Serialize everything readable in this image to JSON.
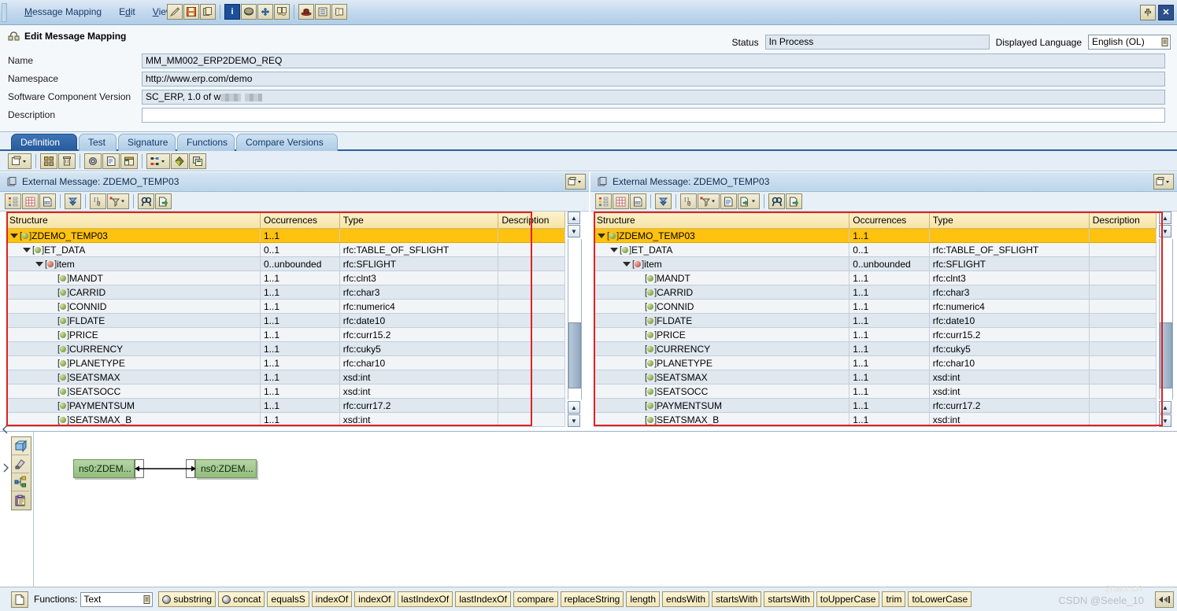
{
  "menubar": {
    "items": [
      {
        "label": "Message Mapping",
        "mnemonic": "M"
      },
      {
        "label": "Edit",
        "mnemonic": "d"
      },
      {
        "label": "View",
        "mnemonic": "V"
      }
    ],
    "toolbar_groups": [
      {
        "icons": [
          "pencil-edit-icon",
          "save-icon",
          "copy-icon"
        ]
      },
      {
        "icons": [
          "info-icon",
          "book-icon",
          "where-used-icon",
          "history-icon"
        ]
      },
      {
        "icons": [
          "hat-icon",
          "list-icon",
          "scroll-icon"
        ]
      }
    ],
    "window_buttons": [
      "pin-icon",
      "close-icon"
    ]
  },
  "header": {
    "title": "Edit Message Mapping",
    "title_icon": "message-mapping-icon",
    "fields": [
      {
        "label": "Name",
        "value": "MM_MM002_ERP2DEMO_REQ",
        "readonly": true
      },
      {
        "label": "Namespace",
        "value": "http://www.erp.com/demo",
        "readonly": true
      },
      {
        "label": "Software Component Version",
        "value": "SC_ERP, 1.0 of w",
        "readonly": true,
        "redacted": true
      },
      {
        "label": "Description",
        "value": "",
        "readonly": false
      }
    ],
    "status_label": "Status",
    "status_value": "In Process",
    "language_label": "Displayed Language",
    "language_value": "English (OL)"
  },
  "tabs": [
    {
      "label": "Definition",
      "active": true
    },
    {
      "label": "Test",
      "active": false
    },
    {
      "label": "Signature",
      "active": false
    },
    {
      "label": "Functions",
      "active": false
    },
    {
      "label": "Compare Versions",
      "active": false
    }
  ],
  "action_toolbar": {
    "groups": [
      {
        "icons": [
          "new-window-dropdown-icon"
        ]
      },
      {
        "icons": [
          "grid-arrange-icon",
          "delete-icon"
        ]
      },
      {
        "icons": [
          "settings-gear-icon",
          "document-properties-icon",
          "layout-icon"
        ]
      },
      {
        "icons": [
          "dependencies-dropdown-icon",
          "value-mapping-icon",
          "copy-object-icon"
        ]
      }
    ]
  },
  "source_pane": {
    "title": "External Message: ZDEMO_TEMP03",
    "title_icon": "message-icon",
    "header_button": "detach-dropdown-icon",
    "toolbar_icons": [
      "tree-view-icon",
      "grid-view-icon",
      "source-text-icon",
      "expand-all-icon",
      "namespace-icon",
      "filter-dropdown-icon",
      "find-icon",
      "export-icon"
    ],
    "columns": [
      "Structure",
      "Occurrences",
      "Type",
      "Description"
    ],
    "rows": [
      {
        "indent": 0,
        "name": "ZDEMO_TEMP03",
        "occurrences": "1..1",
        "type": "",
        "description": "",
        "expandable": true,
        "expanded": true,
        "ball": "green",
        "selected": true
      },
      {
        "indent": 1,
        "name": "ET_DATA",
        "occurrences": "0..1",
        "type": "rfc:TABLE_OF_SFLIGHT",
        "description": "",
        "expandable": true,
        "expanded": true,
        "ball": "green",
        "selected": false
      },
      {
        "indent": 2,
        "name": "item",
        "occurrences": "0..unbounded",
        "type": "rfc:SFLIGHT",
        "description": "",
        "expandable": true,
        "expanded": true,
        "ball": "red",
        "selected": false
      },
      {
        "indent": 3,
        "name": "MANDT",
        "occurrences": "1..1",
        "type": "rfc:clnt3",
        "description": "",
        "expandable": false,
        "expanded": false,
        "ball": "green",
        "selected": false
      },
      {
        "indent": 3,
        "name": "CARRID",
        "occurrences": "1..1",
        "type": "rfc:char3",
        "description": "",
        "expandable": false,
        "expanded": false,
        "ball": "green",
        "selected": false
      },
      {
        "indent": 3,
        "name": "CONNID",
        "occurrences": "1..1",
        "type": "rfc:numeric4",
        "description": "",
        "expandable": false,
        "expanded": false,
        "ball": "green",
        "selected": false
      },
      {
        "indent": 3,
        "name": "FLDATE",
        "occurrences": "1..1",
        "type": "rfc:date10",
        "description": "",
        "expandable": false,
        "expanded": false,
        "ball": "green",
        "selected": false
      },
      {
        "indent": 3,
        "name": "PRICE",
        "occurrences": "1..1",
        "type": "rfc:curr15.2",
        "description": "",
        "expandable": false,
        "expanded": false,
        "ball": "green",
        "selected": false
      },
      {
        "indent": 3,
        "name": "CURRENCY",
        "occurrences": "1..1",
        "type": "rfc:cuky5",
        "description": "",
        "expandable": false,
        "expanded": false,
        "ball": "green",
        "selected": false
      },
      {
        "indent": 3,
        "name": "PLANETYPE",
        "occurrences": "1..1",
        "type": "rfc:char10",
        "description": "",
        "expandable": false,
        "expanded": false,
        "ball": "green",
        "selected": false
      },
      {
        "indent": 3,
        "name": "SEATSMAX",
        "occurrences": "1..1",
        "type": "xsd:int",
        "description": "",
        "expandable": false,
        "expanded": false,
        "ball": "green",
        "selected": false
      },
      {
        "indent": 3,
        "name": "SEATSOCC",
        "occurrences": "1..1",
        "type": "xsd:int",
        "description": "",
        "expandable": false,
        "expanded": false,
        "ball": "green",
        "selected": false
      },
      {
        "indent": 3,
        "name": "PAYMENTSUM",
        "occurrences": "1..1",
        "type": "rfc:curr17.2",
        "description": "",
        "expandable": false,
        "expanded": false,
        "ball": "green",
        "selected": false
      },
      {
        "indent": 3,
        "name": "SEATSMAX_B",
        "occurrences": "1..1",
        "type": "xsd:int",
        "description": "",
        "expandable": false,
        "expanded": false,
        "ball": "green",
        "selected": false
      }
    ]
  },
  "target_pane": {
    "title": "External Message: ZDEMO_TEMP03",
    "title_icon": "message-icon",
    "header_button": "detach-dropdown-icon",
    "toolbar_icons": [
      "tree-view-icon",
      "grid-view-icon",
      "source-text-icon",
      "expand-all-icon",
      "namespace-icon",
      "filter-dropdown-icon",
      "document-properties-icon",
      "export-dropdown-icon",
      "find-icon",
      "export-icon"
    ],
    "columns": [
      "Structure",
      "Occurrences",
      "Type",
      "Description"
    ],
    "rows": [
      {
        "indent": 0,
        "name": "ZDEMO_TEMP03",
        "occurrences": "1..1",
        "type": "",
        "description": "",
        "expandable": true,
        "expanded": true,
        "ball": "green",
        "selected": true
      },
      {
        "indent": 1,
        "name": "ET_DATA",
        "occurrences": "0..1",
        "type": "rfc:TABLE_OF_SFLIGHT",
        "description": "",
        "expandable": true,
        "expanded": true,
        "ball": "green",
        "selected": false
      },
      {
        "indent": 2,
        "name": "item",
        "occurrences": "0..unbounded",
        "type": "rfc:SFLIGHT",
        "description": "",
        "expandable": true,
        "expanded": true,
        "ball": "red",
        "selected": false
      },
      {
        "indent": 3,
        "name": "MANDT",
        "occurrences": "1..1",
        "type": "rfc:clnt3",
        "description": "",
        "expandable": false,
        "expanded": false,
        "ball": "green",
        "selected": false
      },
      {
        "indent": 3,
        "name": "CARRID",
        "occurrences": "1..1",
        "type": "rfc:char3",
        "description": "",
        "expandable": false,
        "expanded": false,
        "ball": "green",
        "selected": false
      },
      {
        "indent": 3,
        "name": "CONNID",
        "occurrences": "1..1",
        "type": "rfc:numeric4",
        "description": "",
        "expandable": false,
        "expanded": false,
        "ball": "green",
        "selected": false
      },
      {
        "indent": 3,
        "name": "FLDATE",
        "occurrences": "1..1",
        "type": "rfc:date10",
        "description": "",
        "expandable": false,
        "expanded": false,
        "ball": "green",
        "selected": false
      },
      {
        "indent": 3,
        "name": "PRICE",
        "occurrences": "1..1",
        "type": "rfc:curr15.2",
        "description": "",
        "expandable": false,
        "expanded": false,
        "ball": "green",
        "selected": false
      },
      {
        "indent": 3,
        "name": "CURRENCY",
        "occurrences": "1..1",
        "type": "rfc:cuky5",
        "description": "",
        "expandable": false,
        "expanded": false,
        "ball": "green",
        "selected": false
      },
      {
        "indent": 3,
        "name": "PLANETYPE",
        "occurrences": "1..1",
        "type": "rfc:char10",
        "description": "",
        "expandable": false,
        "expanded": false,
        "ball": "green",
        "selected": false
      },
      {
        "indent": 3,
        "name": "SEATSMAX",
        "occurrences": "1..1",
        "type": "xsd:int",
        "description": "",
        "expandable": false,
        "expanded": false,
        "ball": "green",
        "selected": false
      },
      {
        "indent": 3,
        "name": "SEATSOCC",
        "occurrences": "1..1",
        "type": "xsd:int",
        "description": "",
        "expandable": false,
        "expanded": false,
        "ball": "green",
        "selected": false
      },
      {
        "indent": 3,
        "name": "PAYMENTSUM",
        "occurrences": "1..1",
        "type": "rfc:curr17.2",
        "description": "",
        "expandable": false,
        "expanded": false,
        "ball": "green",
        "selected": false
      },
      {
        "indent": 3,
        "name": "SEATSMAX_B",
        "occurrences": "1..1",
        "type": "xsd:int",
        "description": "",
        "expandable": false,
        "expanded": false,
        "ball": "green",
        "selected": false
      }
    ]
  },
  "mapping_area": {
    "tool_icons": [
      "create-mapping-icon",
      "eraser-icon",
      "layout-tree-icon",
      "paste-icon"
    ],
    "nodes": [
      {
        "label": "ns0:ZDEM...",
        "side": "source"
      },
      {
        "label": "ns0:ZDEM...",
        "side": "target"
      }
    ]
  },
  "function_bar": {
    "icon": "function-document-icon",
    "label": "Functions:",
    "category_value": "Text",
    "buttons": [
      {
        "label": "substring",
        "has_gear": true
      },
      {
        "label": "concat",
        "has_gear": true
      },
      {
        "label": "equalsS",
        "has_gear": false
      },
      {
        "label": "indexOf",
        "has_gear": false
      },
      {
        "label": "indexOf",
        "has_gear": false
      },
      {
        "label": "lastIndexOf",
        "has_gear": false
      },
      {
        "label": "lastIndexOf",
        "has_gear": false
      },
      {
        "label": "compare",
        "has_gear": false
      },
      {
        "label": "replaceString",
        "has_gear": false
      },
      {
        "label": "length",
        "has_gear": false
      },
      {
        "label": "endsWith",
        "has_gear": false
      },
      {
        "label": "startsWith",
        "has_gear": false
      },
      {
        "label": "startsWith",
        "has_gear": false
      },
      {
        "label": "toUpperCase",
        "has_gear": false
      },
      {
        "label": "trim",
        "has_gear": false
      },
      {
        "label": "toLowerCase",
        "has_gear": false
      }
    ],
    "right_icon": "more-functions-icon"
  },
  "watermark": {
    "text": "CSDN @Seele_10",
    "faint_text": "znwx.cn"
  },
  "colors": {
    "accent_blue": "#255a9c",
    "header_yellow": "#f6e3a6",
    "selected_row": "#ffc20e",
    "annotation_red": "#e02020",
    "node_green": "#93bd7d"
  }
}
